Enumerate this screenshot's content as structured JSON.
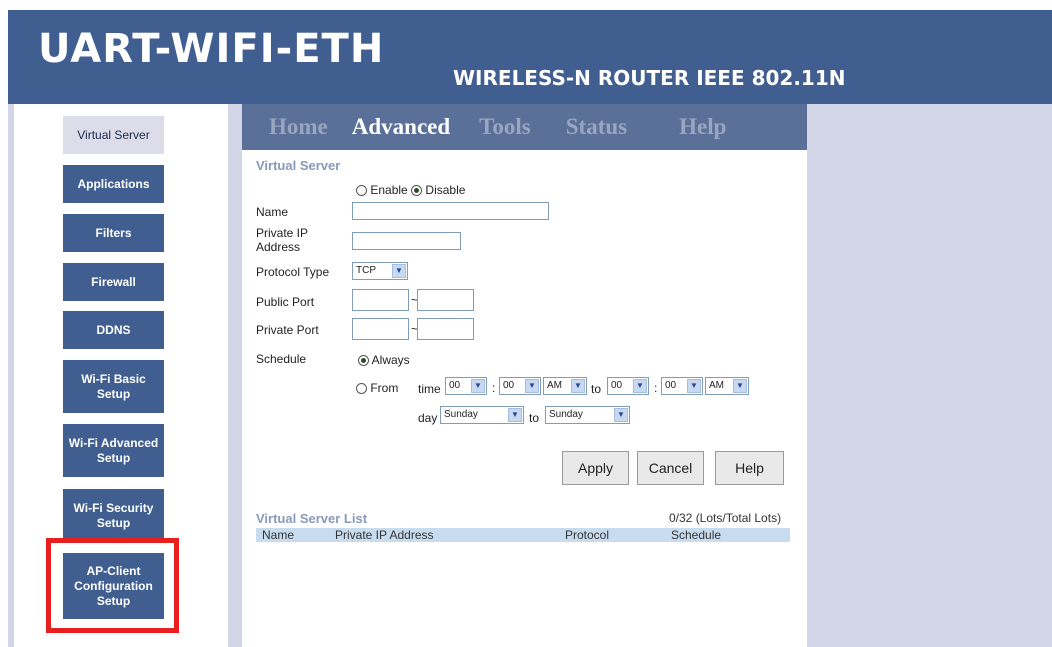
{
  "header": {
    "brand": "UART-WIFI-ETH",
    "subtitle": "WIRELESS-N ROUTER IEEE 802.11N"
  },
  "sidebar": {
    "items": [
      {
        "label": "Virtual Server",
        "active": true
      },
      {
        "label": "Applications"
      },
      {
        "label": "Filters"
      },
      {
        "label": "Firewall"
      },
      {
        "label": "DDNS"
      },
      {
        "label": "Wi-Fi Basic Setup"
      },
      {
        "label": "Wi-Fi Advanced Setup"
      },
      {
        "label": "Wi-Fi Security Setup"
      },
      {
        "label": "AP-Client Configuration Setup"
      }
    ],
    "highlight_color": "#e81f1f"
  },
  "topnav": {
    "tabs": [
      "Home",
      "Advanced",
      "Tools",
      "Status",
      "Help"
    ],
    "current": "Advanced"
  },
  "form": {
    "title": "Virtual Server",
    "enable_label": "Enable",
    "disable_label": "Disable",
    "enabled": false,
    "name_label": "Name",
    "name_value": "",
    "private_ip_label": "Private IP Address",
    "private_ip_value": "",
    "protocol_label": "Protocol Type",
    "protocol_value": "TCP",
    "public_port_label": "Public Port",
    "private_port_label": "Private Port",
    "tilde": "~",
    "schedule_label": "Schedule",
    "always_label": "Always",
    "from_label": "From",
    "time_label": "time",
    "colon": ":",
    "to_label": "to",
    "day_label": "day",
    "start_hour": "00",
    "start_min": "00",
    "start_ampm": "AM",
    "end_hour": "00",
    "end_min": "00",
    "end_ampm": "AM",
    "start_day": "Sunday",
    "end_day": "Sunday"
  },
  "buttons": {
    "apply": "Apply",
    "cancel": "Cancel",
    "help": "Help"
  },
  "list": {
    "title": "Virtual Server List",
    "count": "0/32 (Lots/Total Lots)",
    "columns": [
      "Name",
      "Private IP Address",
      "Protocol",
      "Schedule"
    ]
  },
  "colors": {
    "header_bg": "#405e8f",
    "nav_bg": "#5a7099",
    "side_bg": "#d3d6e6"
  }
}
